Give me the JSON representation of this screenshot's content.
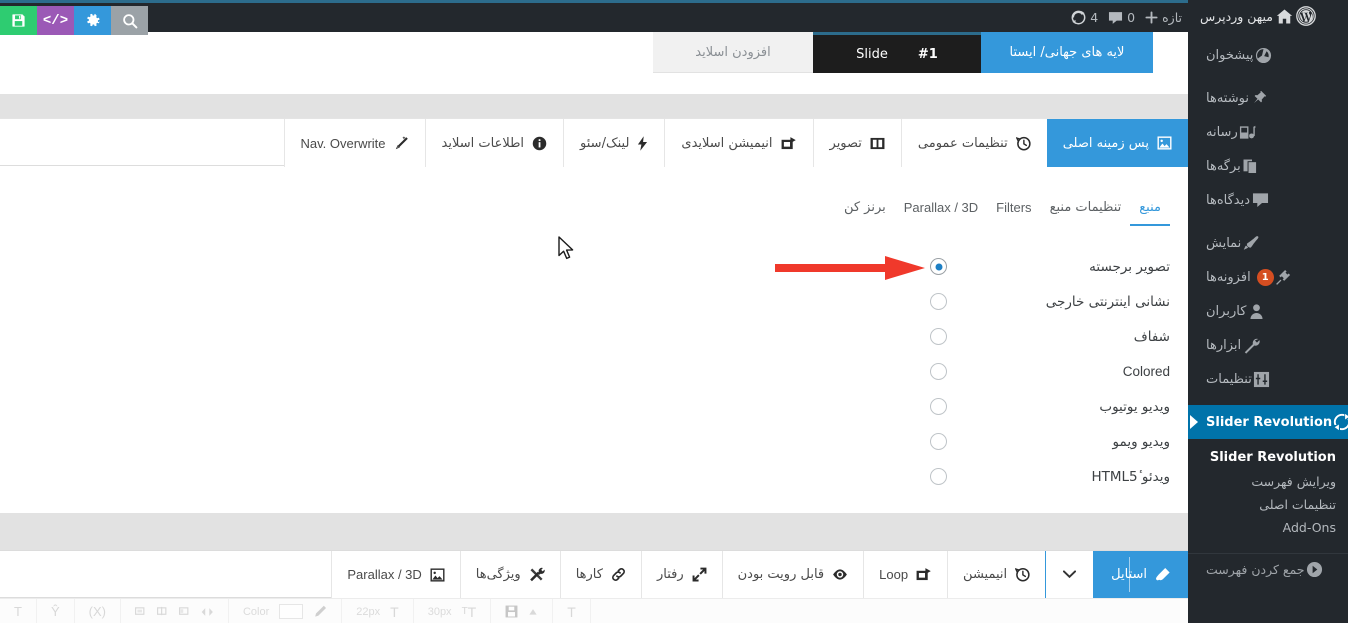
{
  "adminbar": {
    "tools": [
      {
        "name": "search-icon",
        "color": "#9ba2a7"
      },
      {
        "name": "gear-icon",
        "color": "#3498db"
      },
      {
        "name": "code-icon",
        "color": "#9b59b6"
      },
      {
        "name": "save-icon",
        "color": "#2ecc71"
      }
    ],
    "items": [
      {
        "label": "تازه",
        "icon": "plus-icon"
      },
      {
        "label": "0",
        "icon": "comment-icon"
      },
      {
        "label": "4",
        "icon": "revolution-icon"
      }
    ]
  },
  "sidebar": {
    "site_name": "میهن وردپرس",
    "logo_icon": "wordpress-logo-icon",
    "home_icon": "home-icon",
    "items": [
      {
        "label": "پیشخوان",
        "icon": "dashboard-icon",
        "badge": ""
      },
      {
        "label": "نوشته‌ها",
        "icon": "pin-icon",
        "badge": ""
      },
      {
        "label": "رسانه",
        "icon": "media-icon",
        "badge": ""
      },
      {
        "label": "برگه‌ها",
        "icon": "page-icon",
        "badge": ""
      },
      {
        "label": "دیدگاه‌ها",
        "icon": "comment-bubble-icon",
        "badge": ""
      },
      {
        "label": "نمایش",
        "icon": "appearance-brush-icon",
        "badge": ""
      },
      {
        "label": "افزونه‌ها",
        "icon": "plugin-icon",
        "badge": "1"
      },
      {
        "label": "کاربران",
        "icon": "users-icon",
        "badge": ""
      },
      {
        "label": "ابزارها",
        "icon": "tools-wrench-icon",
        "badge": ""
      },
      {
        "label": "تنظیمات",
        "icon": "settings-sliders-icon",
        "badge": ""
      }
    ],
    "active_item": {
      "label": "Slider Revolution",
      "icon": "revolution-icon"
    },
    "submenu": [
      {
        "label": "Slider Revolution",
        "current": true
      },
      {
        "label": "ویرایش فهرست",
        "current": false
      },
      {
        "label": "تنظیمات اصلی",
        "current": false
      },
      {
        "label": "Add-Ons",
        "current": false
      }
    ],
    "collapse": {
      "label": "جمع کردن فهرست",
      "icon": "collapse-icon"
    }
  },
  "slide_strip": {
    "global_layers_tab": "لایه های جهانی/ ایستا",
    "current_slide_label": "Slide",
    "current_slide_number": "#1",
    "add_slide_tab": "افزودن اسلاید"
  },
  "main_tabs": [
    {
      "label": "پس زمینه اصلی",
      "icon": "image-icon",
      "active": true,
      "latin": false
    },
    {
      "label": "تنظیمات عمومی",
      "icon": "clock-history-icon",
      "active": false,
      "latin": false
    },
    {
      "label": "تصویر",
      "icon": "filmstrip-icon",
      "active": false,
      "latin": false
    },
    {
      "label": "انیمیشن اسلایدی",
      "icon": "transition-icon",
      "active": false,
      "latin": false
    },
    {
      "label": "لینک/سئو",
      "icon": "bolt-icon",
      "active": false,
      "latin": false
    },
    {
      "label": "اطلاعات اسلاید",
      "icon": "info-icon",
      "active": false,
      "latin": false
    },
    {
      "label": "Nav. Overwrite",
      "icon": "magic-wand-icon",
      "active": false,
      "latin": true
    }
  ],
  "sub_tabs": [
    {
      "label": "منبع",
      "active": true,
      "latin": false
    },
    {
      "label": "تنظیمات منبع",
      "active": false,
      "latin": false
    },
    {
      "label": "Filters",
      "active": false,
      "latin": true
    },
    {
      "label": "Parallax / 3D",
      "active": false,
      "latin": true
    },
    {
      "label": "برنز کن",
      "active": false,
      "latin": false
    }
  ],
  "source_options": [
    {
      "label": "تصویر برجسته",
      "checked": true,
      "latin": false
    },
    {
      "label": "نشانی اینترنتی خارجی",
      "checked": false,
      "latin": false
    },
    {
      "label": "شفاف",
      "checked": false,
      "latin": false
    },
    {
      "label": "Colored",
      "checked": false,
      "latin": true
    },
    {
      "label": "ویدیو یوتیوب",
      "checked": false,
      "latin": false
    },
    {
      "label": "ویدیو ویمو",
      "checked": false,
      "latin": false
    },
    {
      "label": "ویدئو ٔHTML5",
      "checked": false,
      "latin": false
    }
  ],
  "annotation": {
    "arrow_color": "#f0392b",
    "points_at": "تصویر برجسته"
  },
  "bottom_tabs": [
    {
      "label": "استایل",
      "icon": "paint-drop-icon",
      "primary": true,
      "latin": false
    },
    {
      "label": "",
      "icon": "chevron-down-icon",
      "primary": false,
      "latin": false,
      "caret": true
    },
    {
      "label": "انیمیشن",
      "icon": "clock-history-icon",
      "primary": false,
      "latin": false
    },
    {
      "label": "Loop",
      "icon": "transition-icon",
      "primary": false,
      "latin": true
    },
    {
      "label": "قابل رویت بودن",
      "icon": "eye-icon",
      "primary": false,
      "latin": false
    },
    {
      "label": "رفتار",
      "icon": "expand-arrows-icon",
      "primary": false,
      "latin": false
    },
    {
      "label": "کارها",
      "icon": "link-chain-icon",
      "primary": false,
      "latin": false
    },
    {
      "label": "ویژگی‌ها",
      "icon": "hammer-wrench-icon",
      "primary": false,
      "latin": false
    },
    {
      "label": "Parallax / 3D",
      "icon": "image-icon",
      "primary": false,
      "latin": true
    }
  ],
  "cutoff_strip": [
    {
      "label": "T",
      "icon": "text-size-icon"
    },
    {
      "label": "",
      "icon": "align-up-icon"
    },
    {
      "label": "22px",
      "icon": ""
    },
    {
      "label": "T",
      "icon": "font-size-icon"
    },
    {
      "label": "30px",
      "icon": ""
    },
    {
      "label": "TT",
      "icon": "line-height-icon"
    },
    {
      "label": "Color",
      "icon": "color-swatch"
    },
    {
      "label": "",
      "icon": "pencil-icon"
    },
    {
      "label": "",
      "icon": "align-group-icon"
    },
    {
      "label": "",
      "icon": "letter-spacing-icon"
    },
    {
      "label": "",
      "icon": "X-icon"
    },
    {
      "label": "",
      "icon": "Y-icon"
    }
  ],
  "colors": {
    "accent_blue": "#3498db",
    "wp_blue": "#0073aa",
    "sidebar_dark": "#23282d",
    "adminbar_dark": "#23282d",
    "badge_orange": "#d54e21",
    "arrow_red": "#f0392b"
  }
}
